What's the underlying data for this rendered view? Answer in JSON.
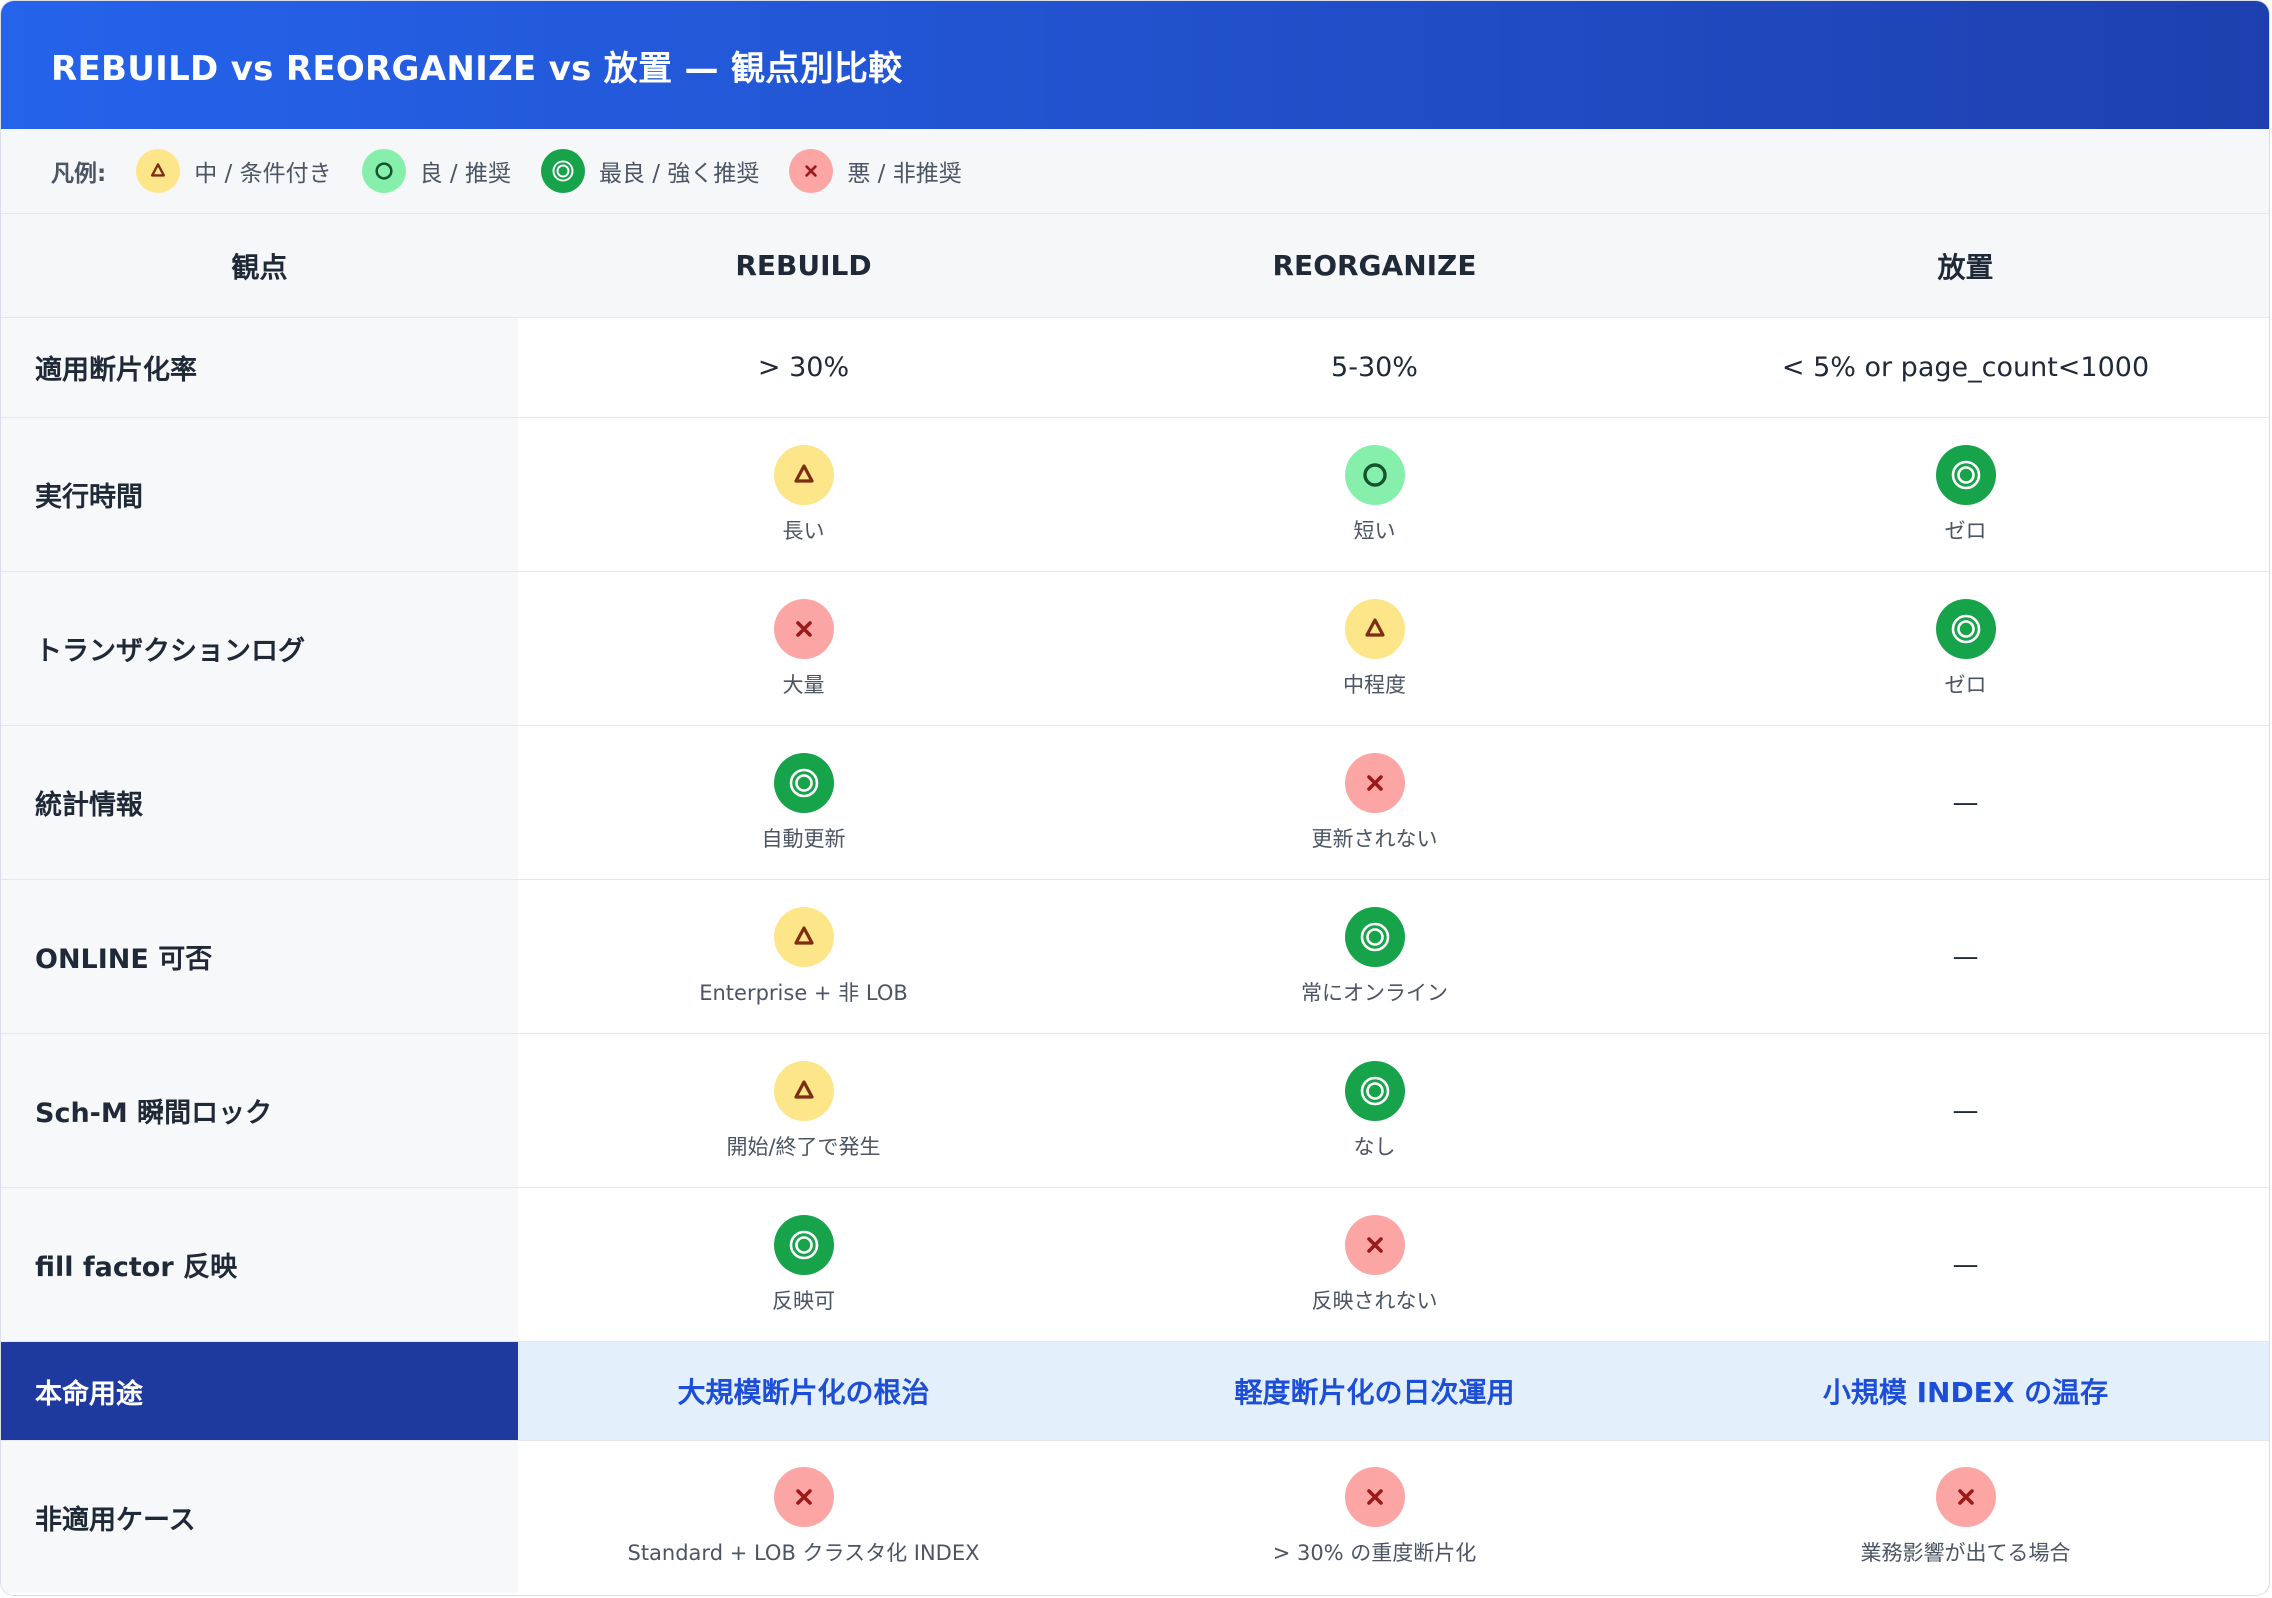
{
  "title": "REBUILD vs REORGANIZE vs 放置 — 観点別比較",
  "colors": {
    "header_start": "#2563eb",
    "header_end": "#1e40af",
    "triangle_bg": "#fde68a",
    "triangle_fg": "#7c2d12",
    "circle_bg": "#86efac",
    "circle_fg": "#14532d",
    "double_circle_bg": "#16a34a",
    "double_circle_fg": "#ffffff",
    "cross_bg": "#fca5a5",
    "cross_fg": "#991b1b",
    "purpose_label_bg": "#1e3a9f",
    "purpose_row_bg": "#e4effc",
    "purpose_text": "#1d4ed8"
  },
  "legend": {
    "label": "凡例:",
    "items": [
      {
        "symbol": "triangle",
        "text": "中 / 条件付き"
      },
      {
        "symbol": "circle",
        "text": "良 / 推奨"
      },
      {
        "symbol": "double-circle",
        "text": "最良 / 強く推奨"
      },
      {
        "symbol": "cross",
        "text": "悪 / 非推奨"
      }
    ]
  },
  "columns": [
    "観点",
    "REBUILD",
    "REORGANIZE",
    "放置"
  ],
  "rows": [
    {
      "label": "適用断片化率",
      "cells": [
        {
          "text": "> 30%"
        },
        {
          "text": "5-30%"
        },
        {
          "text": "< 5% or page_count<1000"
        }
      ]
    },
    {
      "label": "実行時間",
      "cells": [
        {
          "symbol": "triangle",
          "note": "長い"
        },
        {
          "symbol": "circle",
          "note": "短い"
        },
        {
          "symbol": "double-circle",
          "note": "ゼロ"
        }
      ]
    },
    {
      "label": "トランザクションログ",
      "cells": [
        {
          "symbol": "cross",
          "note": "大量"
        },
        {
          "symbol": "triangle",
          "note": "中程度"
        },
        {
          "symbol": "double-circle",
          "note": "ゼロ"
        }
      ]
    },
    {
      "label": "統計情報",
      "cells": [
        {
          "symbol": "double-circle",
          "note": "自動更新"
        },
        {
          "symbol": "cross",
          "note": "更新されない"
        },
        {
          "dash": "—"
        }
      ]
    },
    {
      "label": "ONLINE 可否",
      "cells": [
        {
          "symbol": "triangle",
          "note": "Enterprise + 非 LOB"
        },
        {
          "symbol": "double-circle",
          "note": "常にオンライン"
        },
        {
          "dash": "—"
        }
      ]
    },
    {
      "label": "Sch-M 瞬間ロック",
      "cells": [
        {
          "symbol": "triangle",
          "note": "開始/終了で発生"
        },
        {
          "symbol": "double-circle",
          "note": "なし"
        },
        {
          "dash": "—"
        }
      ]
    },
    {
      "label": "fill factor 反映",
      "cells": [
        {
          "symbol": "double-circle",
          "note": "反映可"
        },
        {
          "symbol": "cross",
          "note": "反映されない"
        },
        {
          "dash": "—"
        }
      ]
    },
    {
      "label": "本命用途",
      "cells": [
        {
          "text": "大規模断片化の根治"
        },
        {
          "text": "軽度断片化の日次運用"
        },
        {
          "text": "小規模 INDEX の温存"
        }
      ]
    },
    {
      "label": "非適用ケース",
      "cells": [
        {
          "symbol": "cross",
          "note": "Standard + LOB クラスタ化 INDEX"
        },
        {
          "symbol": "cross",
          "note": "> 30% の重度断片化"
        },
        {
          "symbol": "cross",
          "note": "業務影響が出てる場合"
        }
      ]
    }
  ]
}
